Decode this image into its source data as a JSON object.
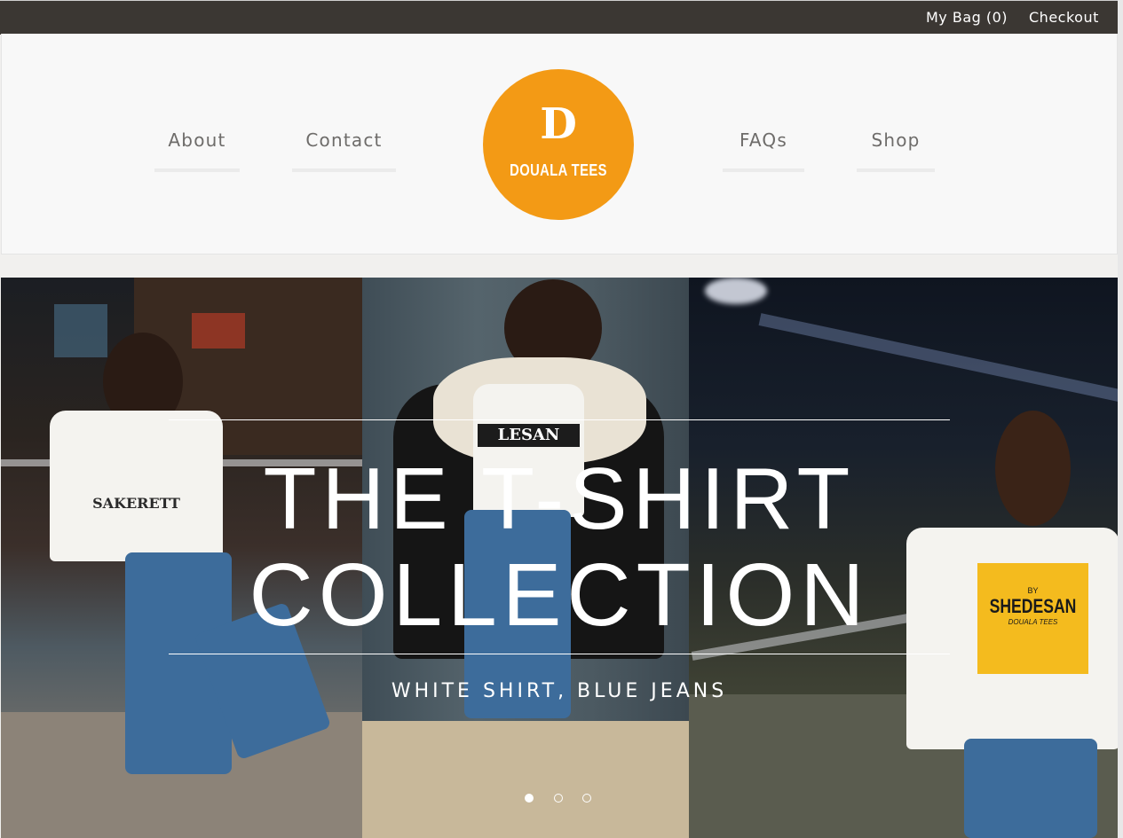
{
  "topbar": {
    "bag_label": "My Bag (0)",
    "checkout_label": "Checkout"
  },
  "nav": {
    "about": "About",
    "contact": "Contact",
    "faqs": "FAQs",
    "shop": "Shop"
  },
  "logo": {
    "mark": "D",
    "text": "DOUALA TEES",
    "color": "#f39a15"
  },
  "hero": {
    "title_line1": "THE T-SHIRT",
    "title_line2": "COLLECTION",
    "subtitle": "WHITE SHIRT, BLUE JEANS",
    "shirts": {
      "sakerett": "SAKERETT",
      "lesan": "LESAN",
      "shedesan_by": "BY",
      "shedesan": "SHEDESAN",
      "shedesan_brand": "DOUALA TEES"
    },
    "slides_total": 3,
    "active_slide": 1
  },
  "colors": {
    "topbar_bg": "#3b3733",
    "accent": "#f39a15"
  }
}
